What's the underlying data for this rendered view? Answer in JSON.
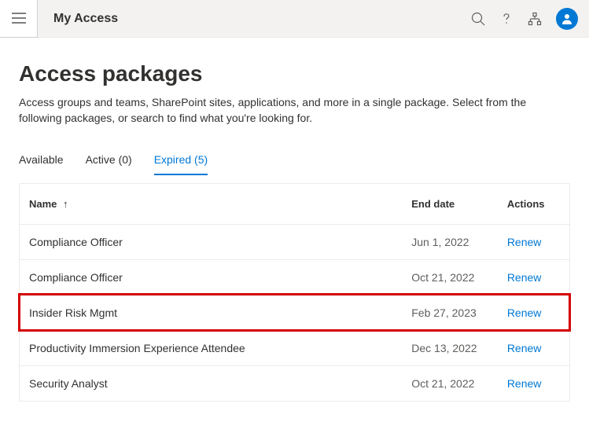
{
  "header": {
    "app_title": "My Access"
  },
  "page": {
    "title": "Access packages",
    "description": "Access groups and teams, SharePoint sites, applications, and more in a single package. Select from the following packages, or search to find what you're looking for."
  },
  "tabs": [
    {
      "label": "Available",
      "active": false
    },
    {
      "label": "Active (0)",
      "active": false
    },
    {
      "label": "Expired (5)",
      "active": true
    }
  ],
  "table": {
    "columns": {
      "name": "Name",
      "end": "End date",
      "actions": "Actions"
    },
    "sort_indicator": "↑",
    "rows": [
      {
        "name": "Compliance Officer",
        "end": "Jun 1, 2022",
        "action": "Renew",
        "highlight": false
      },
      {
        "name": "Compliance Officer",
        "end": "Oct 21, 2022",
        "action": "Renew",
        "highlight": false
      },
      {
        "name": "Insider Risk Mgmt",
        "end": "Feb 27, 2023",
        "action": "Renew",
        "highlight": true
      },
      {
        "name": "Productivity Immersion Experience Attendee",
        "end": "Dec 13, 2022",
        "action": "Renew",
        "highlight": false
      },
      {
        "name": "Security Analyst",
        "end": "Oct 21, 2022",
        "action": "Renew",
        "highlight": false
      }
    ]
  },
  "icons": {
    "search": "search-icon",
    "help": "help-icon",
    "sitemap": "sitemap-icon",
    "avatar": "user-avatar"
  }
}
